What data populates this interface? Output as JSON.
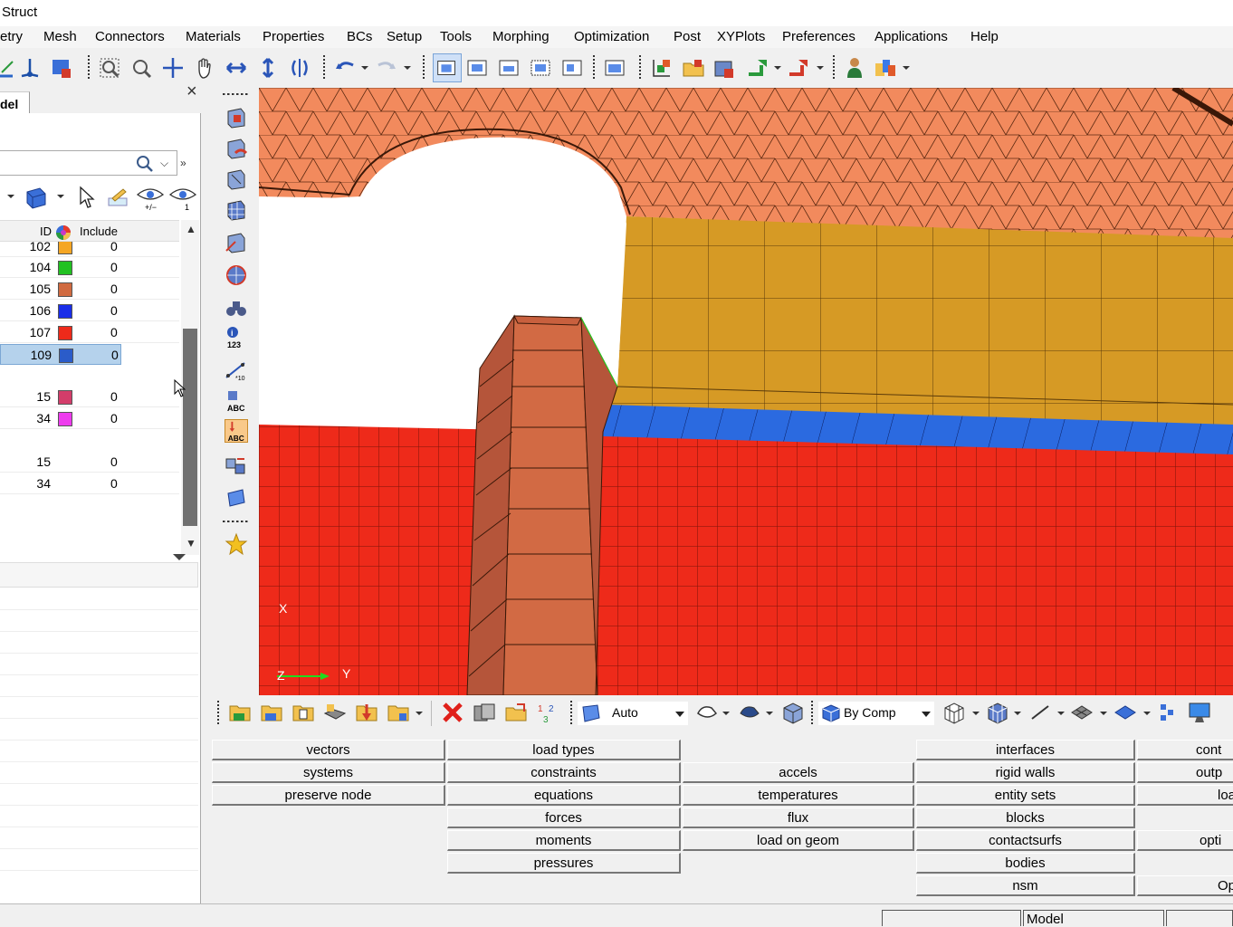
{
  "window": {
    "title": "Struct"
  },
  "menu": [
    "etry",
    "Mesh",
    "Connectors",
    "Materials",
    "Properties",
    "BCs",
    "Setup",
    "Tools",
    "Morphing",
    "Optimization",
    "Post",
    "XYPlots",
    "Preferences",
    "Applications",
    "Help"
  ],
  "browser": {
    "tab_label": "del",
    "columns": {
      "id": "ID",
      "include": "Include"
    },
    "rows": [
      {
        "id": "102",
        "color": "#f5a623",
        "include": "0"
      },
      {
        "id": "104",
        "color": "#22c122",
        "include": "0"
      },
      {
        "id": "105",
        "color": "#d06a40",
        "include": "0"
      },
      {
        "id": "106",
        "color": "#1a2ee8",
        "include": "0"
      },
      {
        "id": "107",
        "color": "#ee2a1a",
        "include": "0"
      },
      {
        "id": "109",
        "color": "#2b5cc9",
        "include": "0",
        "selected": true
      },
      {
        "id": "15",
        "color": "#d33d6a",
        "include": "0"
      },
      {
        "id": "34",
        "color": "#ee3bee",
        "include": "0"
      },
      {
        "id": "15",
        "color": "",
        "include": "0"
      },
      {
        "id": "34",
        "color": "",
        "include": "0"
      }
    ]
  },
  "viewport": {
    "axis_x": "X",
    "axis_y": "Y",
    "axis_z": "Z"
  },
  "bottom_toolbar": {
    "mesh_mode": "Auto",
    "color_mode": "By Comp"
  },
  "bc_panel": {
    "col1": [
      "vectors",
      "systems",
      "preserve node"
    ],
    "col2": [
      "load types",
      "constraints",
      "equations",
      "forces",
      "moments",
      "pressures"
    ],
    "col3": [
      "accels",
      "temperatures",
      "flux",
      "load on geom"
    ],
    "col4": [
      "interfaces",
      "rigid walls",
      "entity sets",
      "blocks",
      "contactsurfs",
      "bodies",
      "nsm"
    ],
    "col5": [
      "cont",
      "outp",
      "loa",
      "",
      "opti",
      "",
      "Op"
    ]
  },
  "status": {
    "model_label": "Model"
  },
  "colors": {
    "accent_selection": "#b5d2ec",
    "viewport_red": "#ee2a1a",
    "viewport_orange": "#f08a5d",
    "viewport_gold": "#d39b2a",
    "viewport_blue": "#2b6ae0"
  }
}
